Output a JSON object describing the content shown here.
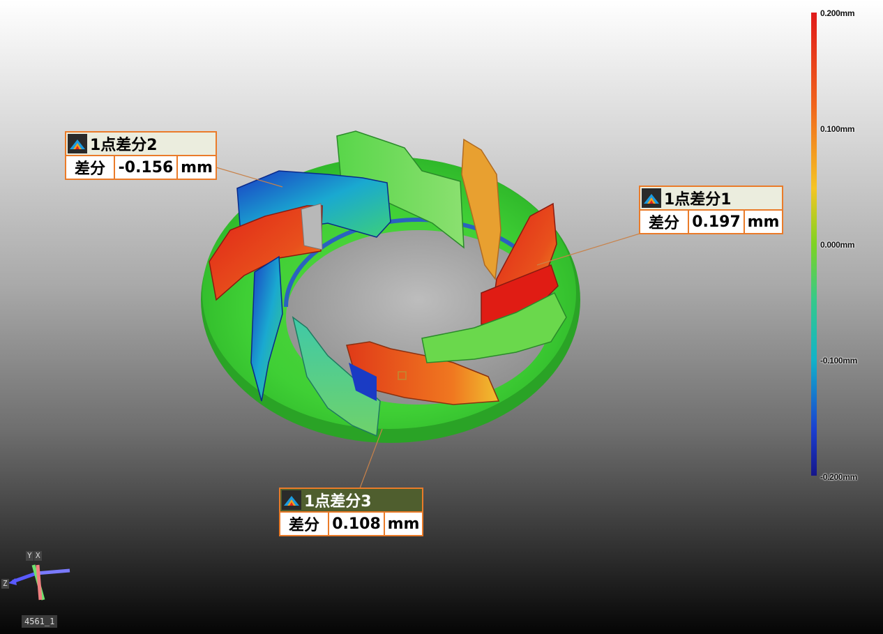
{
  "callouts": [
    {
      "id": "c2",
      "title": "1点差分2",
      "label": "差分",
      "value": "-0.156",
      "unit": "mm"
    },
    {
      "id": "c1",
      "title": "1点差分1",
      "label": "差分",
      "value": "0.197",
      "unit": "mm"
    },
    {
      "id": "c3",
      "title": "1点差分3",
      "label": "差分",
      "value": "0.108",
      "unit": "mm"
    }
  ],
  "legend": {
    "labels": [
      "0.200mm",
      "0.100mm",
      "0.000mm",
      "-0.100mm",
      "-0.200mm"
    ],
    "max_color": "#e01a1a",
    "mid_color": "#7ed321",
    "min_color": "#16168a"
  },
  "axis": {
    "y": "Y",
    "x": "X",
    "z": "Z"
  },
  "model_name": "4561_1",
  "colors": {
    "callout_border": "#ea7b29",
    "leader_line": "#c8824a"
  },
  "icons": {
    "measurement": "deviation-map-icon"
  }
}
